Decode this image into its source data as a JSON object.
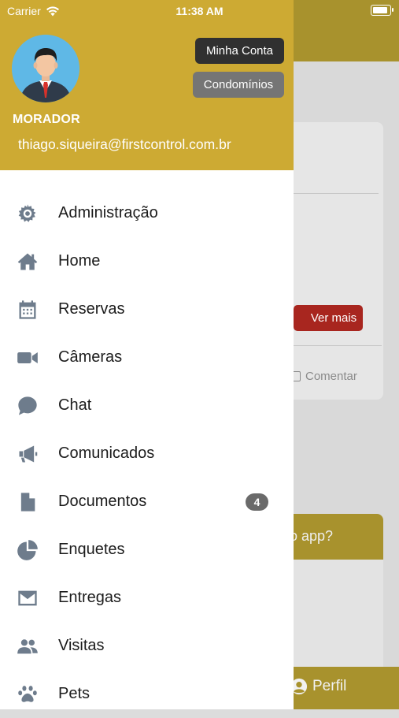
{
  "status_bar": {
    "carrier": "Carrier",
    "time": "11:38 AM"
  },
  "drawer": {
    "role": "MORADOR",
    "email": "thiago.siqueira@firstcontrol.com.br",
    "buttons": {
      "minha_conta": "Minha Conta",
      "condominios": "Condomínios"
    },
    "menu": [
      {
        "label": "Administração",
        "icon": "gear-icon"
      },
      {
        "label": "Home",
        "icon": "home-icon"
      },
      {
        "label": "Reservas",
        "icon": "calendar-icon"
      },
      {
        "label": "Câmeras",
        "icon": "video-camera-icon"
      },
      {
        "label": "Chat",
        "icon": "chat-bubble-icon"
      },
      {
        "label": "Comunicados",
        "icon": "megaphone-icon"
      },
      {
        "label": "Documentos",
        "icon": "document-icon",
        "badge": "4"
      },
      {
        "label": "Enquetes",
        "icon": "pie-chart-icon"
      },
      {
        "label": "Entregas",
        "icon": "envelope-icon"
      },
      {
        "label": "Visitas",
        "icon": "users-icon"
      },
      {
        "label": "Pets",
        "icon": "paw-icon"
      }
    ]
  },
  "background": {
    "ver_mais": "Ver mais",
    "comentar": "Comentar",
    "card_partial_text": "o app?",
    "bottom_tab_perfil": "Perfil"
  },
  "colors": {
    "drawer_header": "#cdaa33",
    "background_header_dimmed": "#a8922d",
    "icon_gray": "#6e7c8c",
    "ver_mais_red": "#a8261f"
  }
}
